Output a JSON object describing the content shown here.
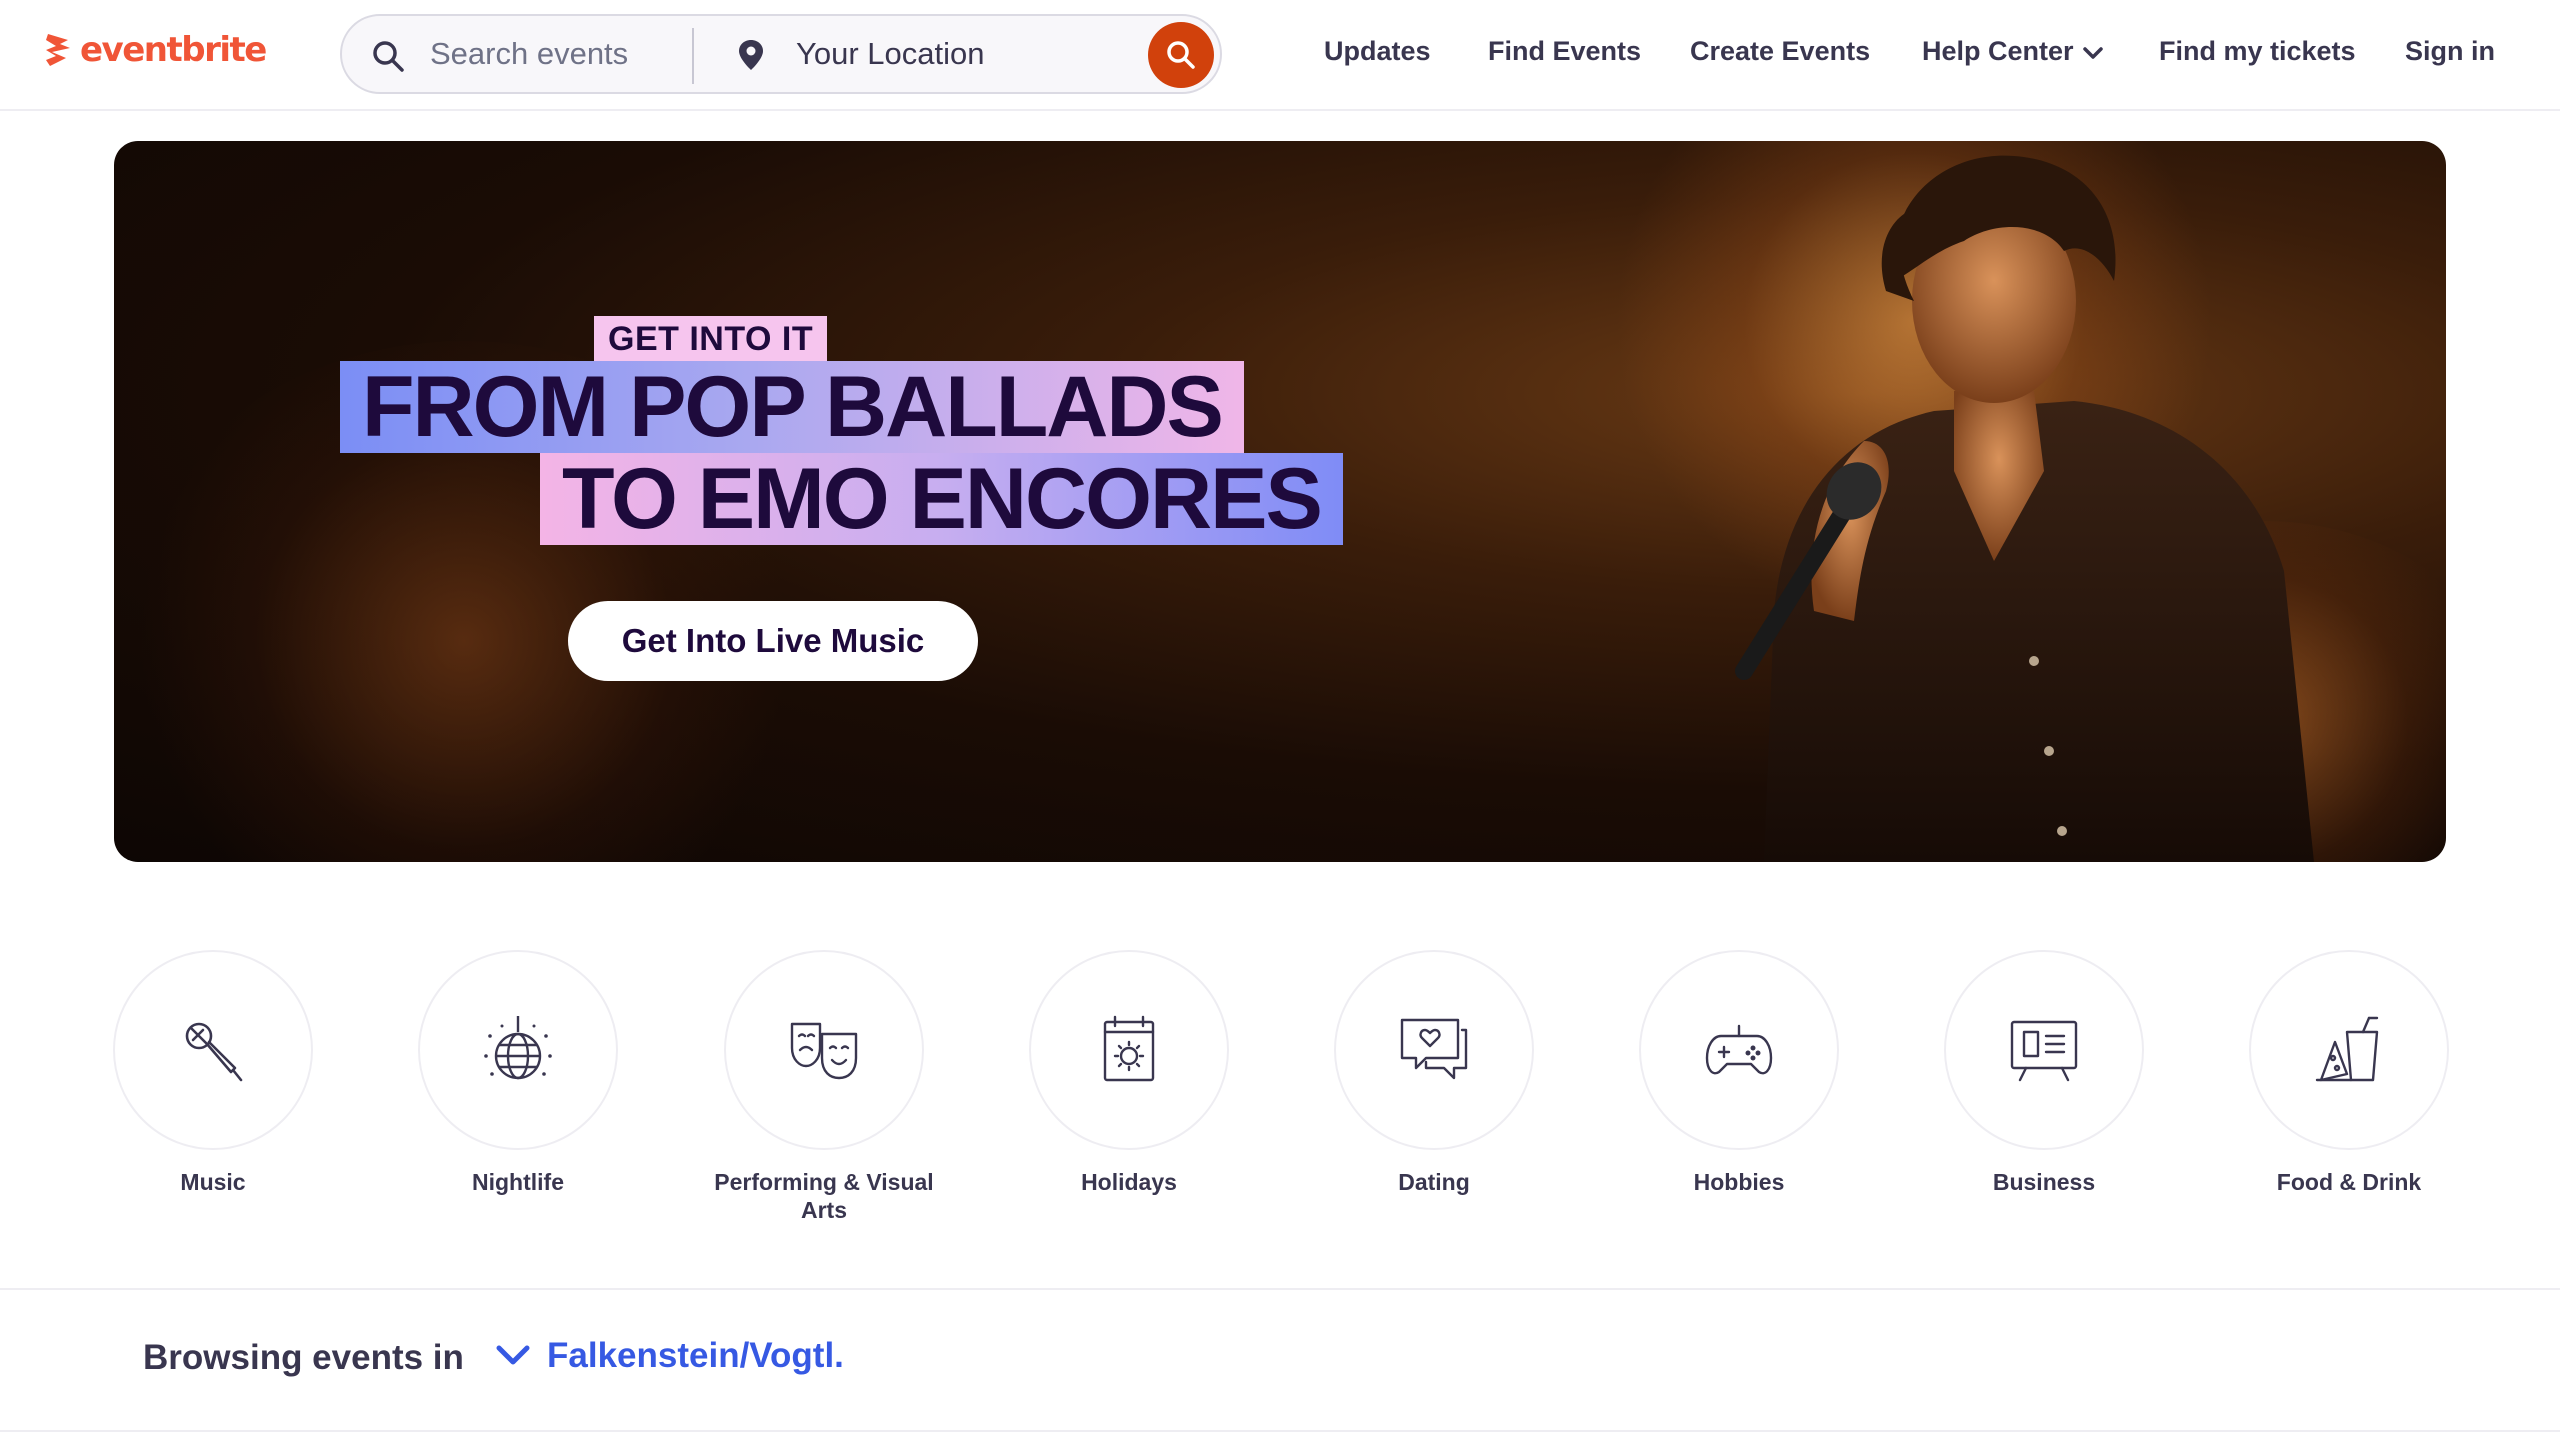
{
  "header": {
    "logo_text": "eventbrite",
    "search": {
      "placeholder": "Search events"
    },
    "location": {
      "placeholder": "Your Location"
    },
    "nav": [
      {
        "label": "Updates"
      },
      {
        "label": "Find Events"
      },
      {
        "label": "Create Events"
      },
      {
        "label": "Help Center"
      },
      {
        "label": "Find my tickets"
      },
      {
        "label": "Sign in"
      }
    ]
  },
  "hero": {
    "tag": "GET INTO IT",
    "line1": "FROM POP BALLADS",
    "line2": "TO EMO ENCORES",
    "cta": "Get Into Live Music"
  },
  "categories": [
    {
      "label": "Music",
      "icon": "microphone-icon"
    },
    {
      "label": "Nightlife",
      "icon": "disco-ball-icon"
    },
    {
      "label": "Performing & Visual Arts",
      "icon": "theater-masks-icon"
    },
    {
      "label": "Holidays",
      "icon": "calendar-sun-icon"
    },
    {
      "label": "Dating",
      "icon": "chat-heart-icon"
    },
    {
      "label": "Hobbies",
      "icon": "game-controller-icon"
    },
    {
      "label": "Business",
      "icon": "presentation-board-icon"
    },
    {
      "label": "Food & Drink",
      "icon": "food-drink-icon"
    }
  ],
  "browsing": {
    "label": "Browsing events in",
    "location": "Falkenstein/Vogtl."
  },
  "colors": {
    "brand": "#f05537",
    "search_button": "#d1410c",
    "link": "#3659e3",
    "text": "#39364f"
  }
}
